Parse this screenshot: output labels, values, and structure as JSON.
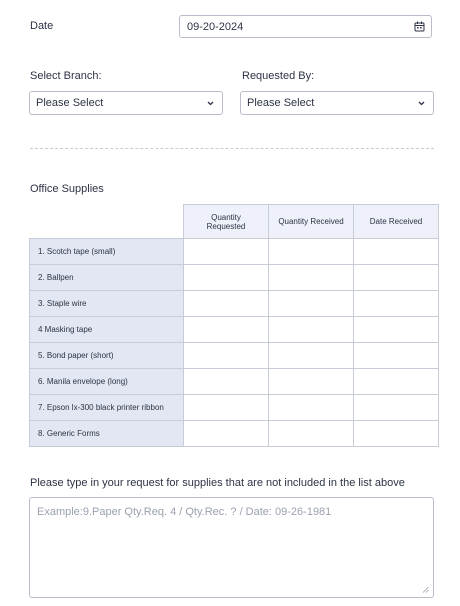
{
  "date": {
    "label": "Date",
    "value": "09-20-2024"
  },
  "branch": {
    "label": "Select Branch:",
    "value": "Please Select"
  },
  "requested_by": {
    "label": "Requested By:",
    "value": "Please Select"
  },
  "supplies": {
    "title": "Office Supplies",
    "columns": [
      "Quantity Requested",
      "Quantity Received",
      "Date Received"
    ],
    "rows": [
      "1. Scotch tape (small)",
      "2. Ballpen",
      "3. Staple wire",
      "4 Masking tape",
      "5. Bond paper (short)",
      "6. Manila envelope (long)",
      "7. Epson lx-300 black printer ribbon",
      "8. Generic Forms"
    ]
  },
  "other_request": {
    "label": "Please type in your request for supplies that are not included in the list above",
    "placeholder": "Example:9.Paper Qty.Req. 4 / Qty.Rec. ? / Date: 09-26-1981"
  }
}
